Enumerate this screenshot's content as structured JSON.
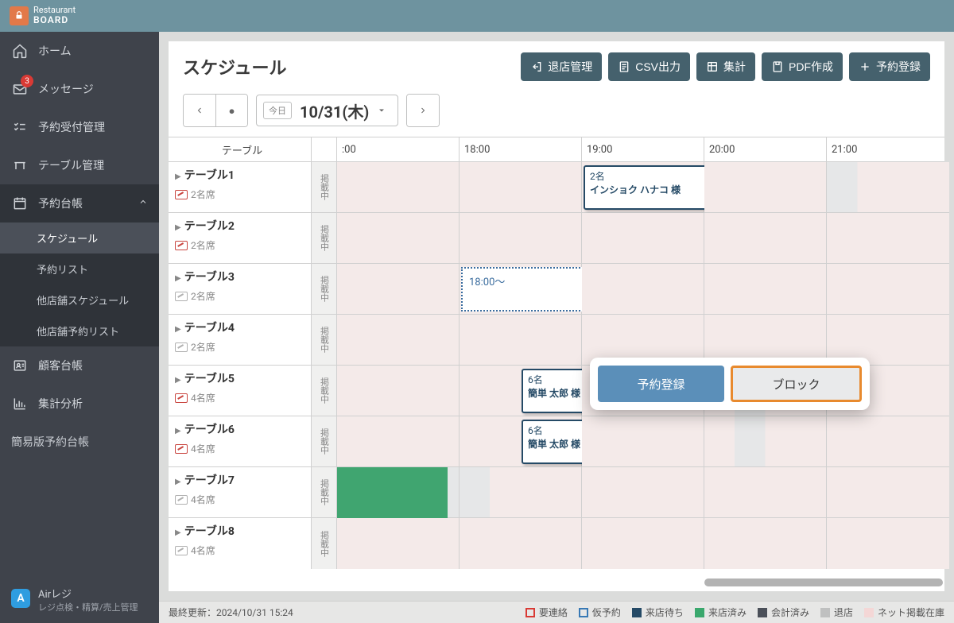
{
  "brand": {
    "top": "Restaurant",
    "name": "BOARD"
  },
  "sidebar": {
    "items": [
      {
        "label": "ホーム"
      },
      {
        "label": "メッセージ",
        "badge": "3"
      },
      {
        "label": "予約受付管理"
      },
      {
        "label": "テーブル管理"
      },
      {
        "label": "予約台帳"
      },
      {
        "label": "顧客台帳"
      },
      {
        "label": "集計分析"
      }
    ],
    "sub": [
      {
        "label": "スケジュール"
      },
      {
        "label": "予約リスト"
      },
      {
        "label": "他店舗スケジュール"
      },
      {
        "label": "他店舗予約リスト"
      }
    ],
    "simple": "簡易版予約台帳",
    "air": {
      "title": "Airレジ",
      "sub": "レジ点検・精算/売上管理"
    }
  },
  "page": {
    "title": "スケジュール",
    "buttons": {
      "close": "退店管理",
      "csv": "CSV出力",
      "aggregate": "集計",
      "pdf": "PDF作成",
      "new": "予約登録"
    },
    "today": "今日",
    "date": "10/31(木)"
  },
  "popover": {
    "reserve": "予約登録",
    "block": "ブロック"
  },
  "columns": {
    "table": "テーブル",
    "times": [
      ":00",
      "18:00",
      "19:00",
      "20:00",
      "21:00"
    ]
  },
  "keisai": "掲載中",
  "rows": [
    {
      "name": "テーブル1",
      "seats": "2名席",
      "seatStyle": "red"
    },
    {
      "name": "テーブル2",
      "seats": "2名席",
      "seatStyle": "red"
    },
    {
      "name": "テーブル3",
      "seats": "2名席",
      "seatStyle": "gray"
    },
    {
      "name": "テーブル4",
      "seats": "2名席",
      "seatStyle": "gray"
    },
    {
      "name": "テーブル5",
      "seats": "4名席",
      "seatStyle": "red"
    },
    {
      "name": "テーブル6",
      "seats": "4名席",
      "seatStyle": "red"
    },
    {
      "name": "テーブル7",
      "seats": "4名席",
      "seatStyle": "gray"
    },
    {
      "name": "テーブル8",
      "seats": "4名席",
      "seatStyle": "gray"
    }
  ],
  "bookings": {
    "b1": {
      "count": "2名",
      "name": "インショク ハナコ 様"
    },
    "b2": {
      "count": "6名",
      "name": "簡単 太郎 様"
    },
    "b3": {
      "count": "6名",
      "name": "簡単 太郎 様"
    }
  },
  "newslot": {
    "text": "18:00〜"
  },
  "footer": {
    "updated": "最終更新：2024/10/31 15:24",
    "legend": [
      {
        "label": "要連絡",
        "color": "#d93a35",
        "fill": false
      },
      {
        "label": "仮予約",
        "color": "#3879b5",
        "fill": false
      },
      {
        "label": "来店待ち",
        "color": "#254a66",
        "fill": true
      },
      {
        "label": "来店済み",
        "color": "#3aa86d",
        "fill": true
      },
      {
        "label": "会計済み",
        "color": "#4b5059",
        "fill": true
      },
      {
        "label": "退店",
        "color": "#bfc0c0",
        "fill": true
      },
      {
        "label": "ネット掲載在庫",
        "color": "#f4d7d6",
        "fill": true
      }
    ]
  }
}
